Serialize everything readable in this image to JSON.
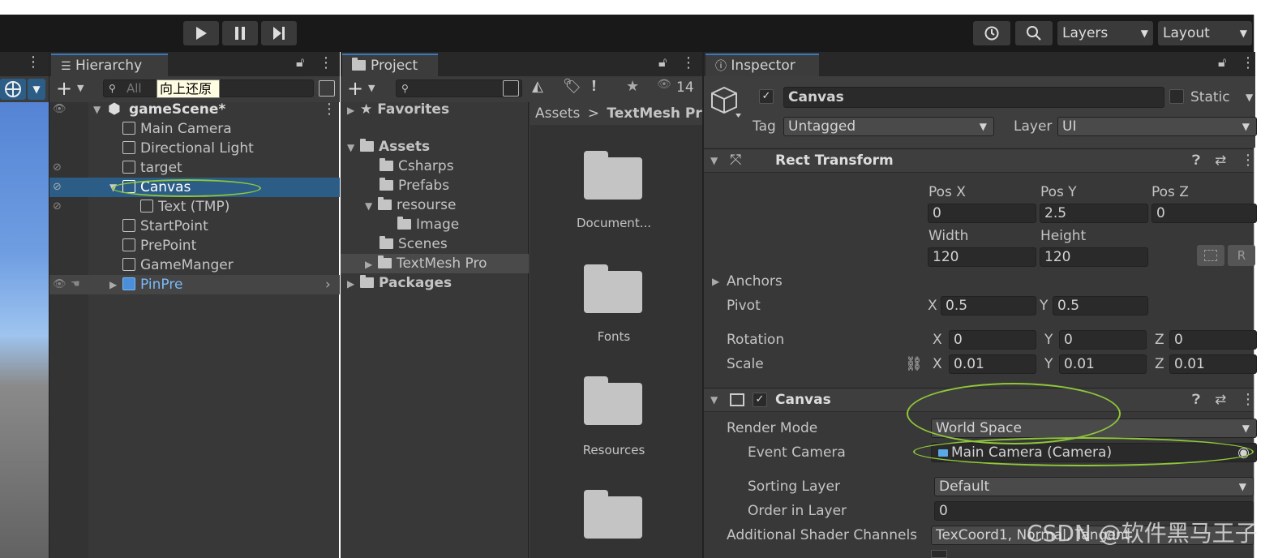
{
  "toolbar": {
    "play_icon": "play-icon",
    "pause_icon": "pause-icon",
    "step_icon": "step-icon",
    "history_icon": "history-icon",
    "search_icon": "search-icon",
    "layers_label": "Layers",
    "layout_label": "Layout"
  },
  "hierarchy": {
    "tab_label": "Hierarchy",
    "search_placeholder": "All",
    "tooltip": "向上还原",
    "scene_name": "gameScene*",
    "items": [
      {
        "label": "Main Camera"
      },
      {
        "label": "Directional Light"
      },
      {
        "label": "target"
      },
      {
        "label": "Canvas"
      },
      {
        "label": "Text (TMP)"
      },
      {
        "label": "StartPoint"
      },
      {
        "label": "PrePoint"
      },
      {
        "label": "GameManger"
      },
      {
        "label": "PinPre"
      }
    ]
  },
  "project": {
    "tab_label": "Project",
    "count": "14",
    "tree": {
      "favorites": "Favorites",
      "assets": "Assets",
      "csharps": "Csharps",
      "prefabs": "Prefabs",
      "resourse": "resourse",
      "image": "Image",
      "scenes": "Scenes",
      "textmeshpro": "TextMesh Pro",
      "packages": "Packages"
    },
    "breadcrumb": {
      "root": "Assets",
      "sep": ">",
      "current": "TextMesh Pro"
    },
    "folders": [
      {
        "label": "Document..."
      },
      {
        "label": "Fonts"
      },
      {
        "label": "Resources"
      }
    ]
  },
  "inspector": {
    "tab_label": "Inspector",
    "object_name": "Canvas",
    "static_label": "Static",
    "tag_label": "Tag",
    "tag_value": "Untagged",
    "layer_label": "Layer",
    "layer_value": "UI",
    "rect_transform": {
      "title": "Rect Transform",
      "posx_label": "Pos X",
      "posx": "0",
      "posy_label": "Pos Y",
      "posy": "2.5",
      "posz_label": "Pos Z",
      "posz": "0",
      "width_label": "Width",
      "width": "120",
      "height_label": "Height",
      "height": "120",
      "r_button": "R",
      "anchors_label": "Anchors",
      "pivot_label": "Pivot",
      "pivot_x_label": "X",
      "pivot_x": "0.5",
      "pivot_y_label": "Y",
      "pivot_y": "0.5",
      "rotation_label": "Rotation",
      "rot_x": "0",
      "rot_y": "0",
      "rot_z": "0",
      "scale_label": "Scale",
      "scale_x": "0.01",
      "scale_y": "0.01",
      "scale_z": "0.01",
      "x_label": "X",
      "y_label": "Y",
      "z_label": "Z"
    },
    "canvas": {
      "title": "Canvas",
      "render_mode_label": "Render Mode",
      "render_mode": "World Space",
      "event_camera_label": "Event Camera",
      "event_camera": "Main Camera (Camera)",
      "sorting_layer_label": "Sorting Layer",
      "sorting_layer": "Default",
      "order_label": "Order in Layer",
      "order": "0",
      "shader_channels_label": "Additional Shader Channels",
      "shader_channels": "TexCoord1, Normal, Tangent"
    }
  },
  "watermark": "CSDN @软件黑马王子",
  "colors": {
    "accent": "#3a79bb",
    "selection": "#2c5d87",
    "annotation": "#8fc73a",
    "prefab": "#7bb9f7"
  }
}
